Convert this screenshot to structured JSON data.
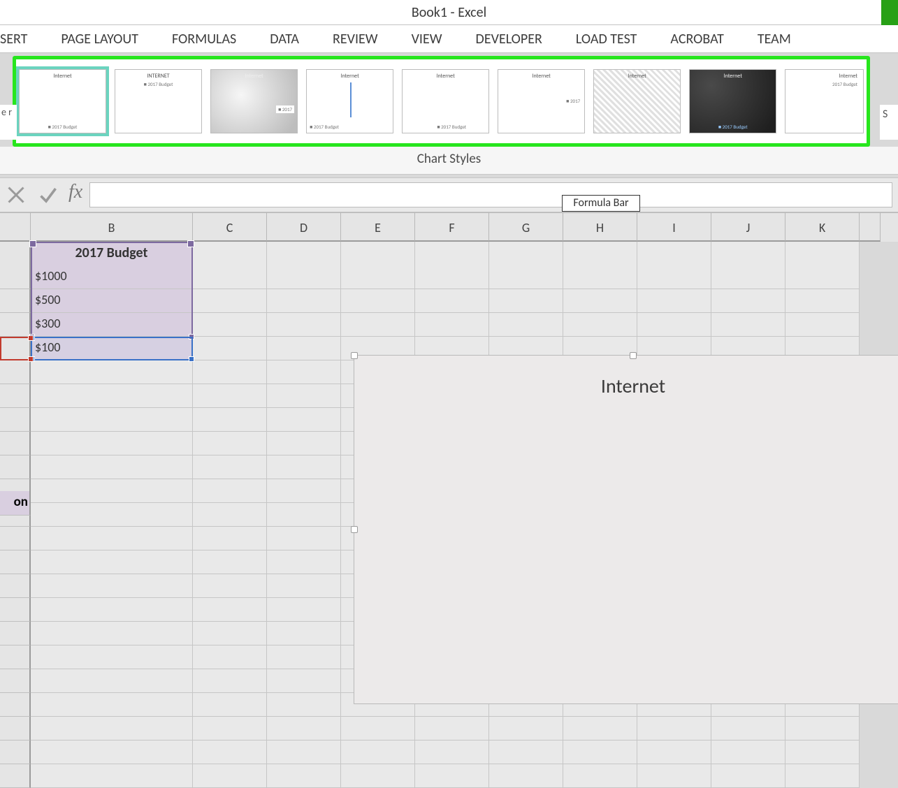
{
  "title": "Book1 - Excel",
  "tabs": [
    "SERT",
    "PAGE LAYOUT",
    "FORMULAS",
    "DATA",
    "REVIEW",
    "VIEW",
    "DEVELOPER",
    "LOAD TEST",
    "ACROBAT",
    "TEAM"
  ],
  "gallery_label": "Chart Styles",
  "left_stub": "e\nr",
  "right_stub": "S",
  "fx_label": "fx",
  "column_headers": [
    "B",
    "C",
    "D",
    "E",
    "F",
    "G",
    "H",
    "I",
    "J",
    "K"
  ],
  "formula_bar_tooltip": "Formula Bar",
  "col_a_partial": "on",
  "cells": {
    "b_header": "2017 Budget",
    "b_values": [
      "$1000",
      "$500",
      "$300",
      "$100"
    ]
  },
  "chart": {
    "title": "Internet"
  },
  "thumbs": {
    "t1_title": "Internet",
    "t2_title": "INTERNET",
    "t3_title": "Internet",
    "t4_title": "Internet",
    "t5_title": "Internet",
    "t6_title": "Internet",
    "t7_title": "Internet",
    "t8_title": "Internet"
  }
}
